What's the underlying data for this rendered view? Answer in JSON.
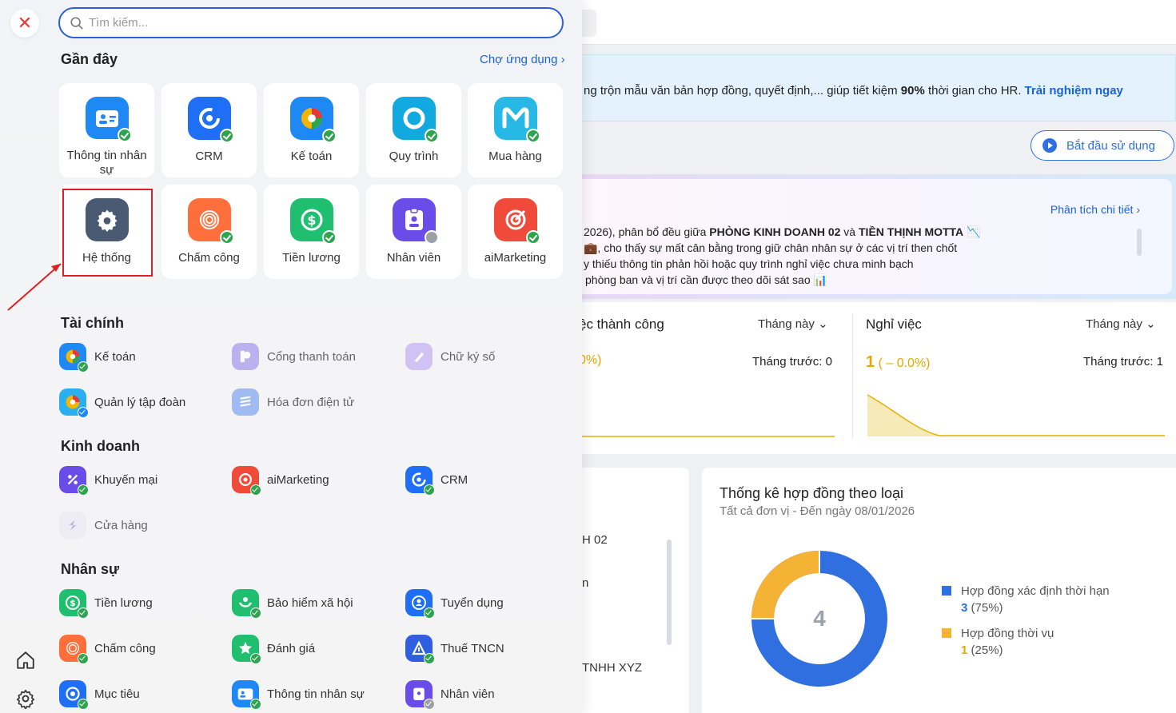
{
  "dashboard": {
    "banner_text": "ng trộn mẫu văn bản hợp đồng, quyết định,... giúp tiết kiệm ",
    "banner_bold": "90%",
    "banner_text2": " thời gian cho HR.",
    "banner_cta": "Trải nghiệm ngay",
    "start_button": "Bắt đầu sử dụng",
    "ai_link": "Phân tích chi tiết",
    "ai_line1_a": "2026), phân bổ đều giữa ",
    "ai_line1_b": "PHÒNG KINH DOANH 02",
    "ai_line1_c": " và ",
    "ai_line1_d": "TIỀN THỊNH MOTTA",
    "ai_line2": "💼, cho thấy sự mất cân bằng trong giữ chân nhân sự ở các vị trí then chốt",
    "ai_line3": "y thiếu thông tin phản hồi hoặc quy trình nghỉ việc chưa minh bạch",
    "ai_line4": "phòng ban và vị trí cần được theo dõi sát sao 📊",
    "stat1": {
      "title": "ệc thành công",
      "period": "Tháng này",
      "prev": "Tháng trước: 0",
      "value": "0%)"
    },
    "stat2": {
      "title": "Nghỉ việc",
      "period": "Tháng này",
      "prev": "Tháng trước: 1",
      "value_main": "1",
      "value_sub": "( – 0.0%)"
    },
    "bottom_left": [
      "H 02",
      "n",
      "TNHH XYZ"
    ],
    "contract": {
      "title": "Thống kê hợp đồng theo loại",
      "subtitle": "Tất cả đơn vị - Đến ngày 08/01/2026",
      "total": "4",
      "legend": [
        {
          "label": "Hợp đồng xác định thời hạn",
          "count": "3",
          "pct": "(75%)",
          "color": "#2f6fe0"
        },
        {
          "label": "Hợp đồng thời vụ",
          "count": "1",
          "pct": "(25%)",
          "color": "#f5b335"
        }
      ]
    }
  },
  "menu": {
    "search_placeholder": "Tìm kiếm...",
    "recent_title": "Gần đây",
    "market_link": "Chợ ứng dụng",
    "recent": [
      {
        "label": "Thông tin nhân sự"
      },
      {
        "label": "CRM"
      },
      {
        "label": "Kế toán"
      },
      {
        "label": "Quy trình"
      },
      {
        "label": "Mua hàng"
      },
      {
        "label": "Hệ thống"
      },
      {
        "label": "Chấm công"
      },
      {
        "label": "Tiền lương"
      },
      {
        "label": "Nhân viên"
      },
      {
        "label": "aiMarketing"
      }
    ],
    "finance_title": "Tài chính",
    "finance": [
      {
        "label": "Kế toán"
      },
      {
        "label": "Cổng thanh toán"
      },
      {
        "label": "Chữ ký số"
      },
      {
        "label": "Quản lý tập đoàn"
      },
      {
        "label": "Hóa đơn điện tử"
      }
    ],
    "business_title": "Kinh doanh",
    "business": [
      {
        "label": "Khuyến mại"
      },
      {
        "label": "aiMarketing"
      },
      {
        "label": "CRM"
      },
      {
        "label": "Cửa hàng"
      }
    ],
    "hr_title": "Nhân sự",
    "hr": [
      {
        "label": "Tiền lương"
      },
      {
        "label": "Bảo hiểm xã hội"
      },
      {
        "label": "Tuyển dụng"
      },
      {
        "label": "Chấm công"
      },
      {
        "label": "Đánh giá"
      },
      {
        "label": "Thuế TNCN"
      },
      {
        "label": "Mục tiêu"
      },
      {
        "label": "Thông tin nhân sự"
      },
      {
        "label": "Nhân viên"
      }
    ]
  }
}
